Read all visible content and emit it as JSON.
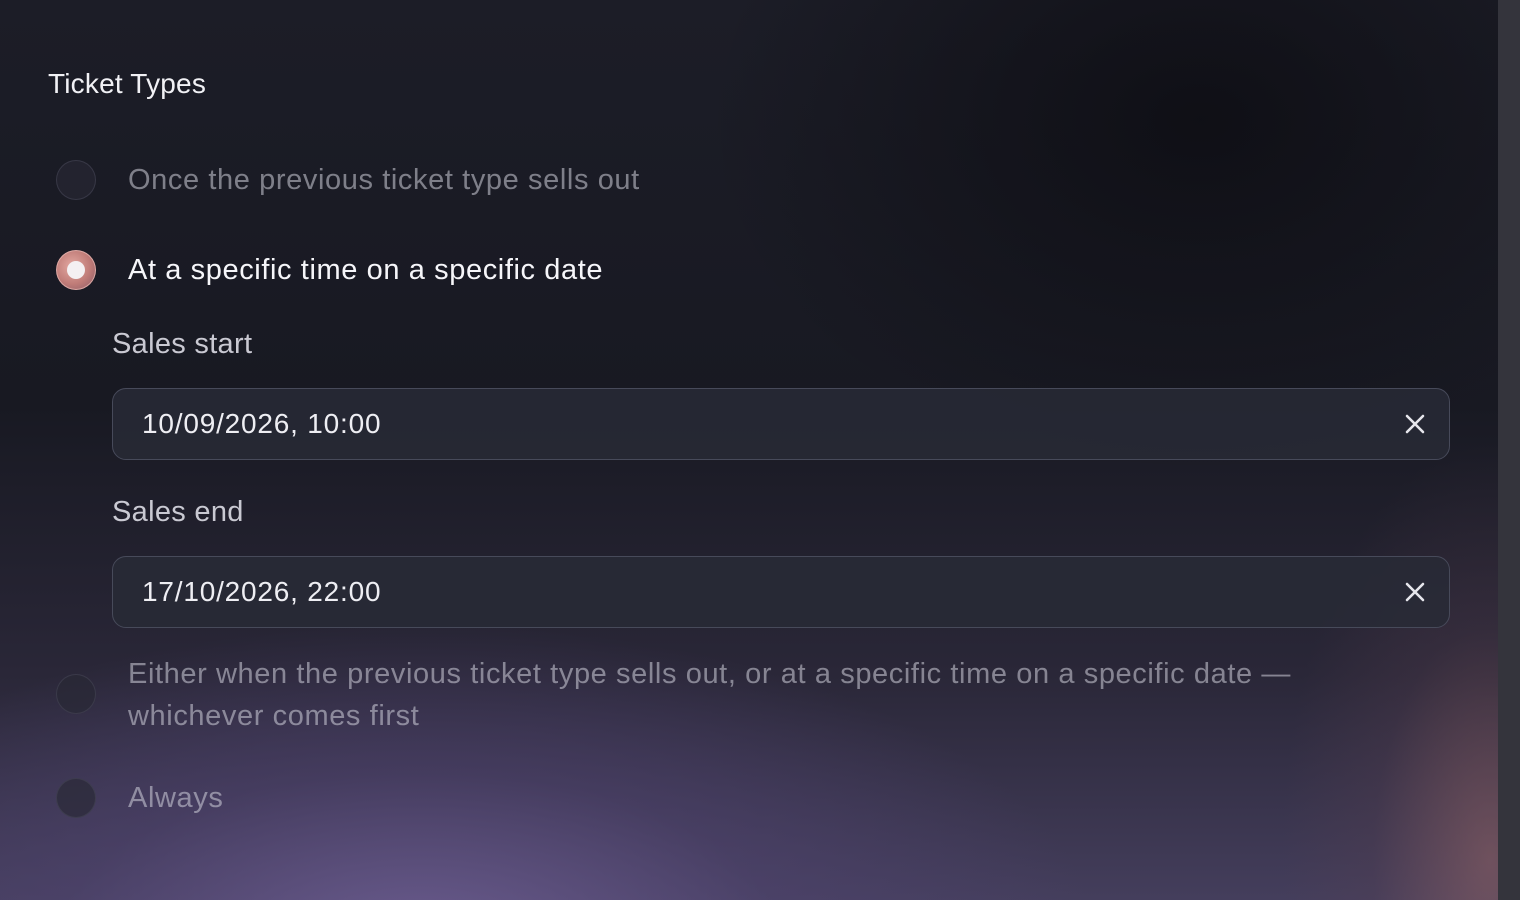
{
  "section": {
    "title": "Ticket Types"
  },
  "options": [
    {
      "label": "Once the previous ticket type sells out",
      "selected": false
    },
    {
      "label": "At a specific time on a specific date",
      "selected": true
    },
    {
      "label": "Either when the previous ticket type sells out, or at a specific time on a specific date — whichever comes first",
      "selected": false
    },
    {
      "label": "Always",
      "selected": false
    }
  ],
  "sales_start": {
    "label": "Sales start",
    "value": "10/09/2026, 10:00",
    "clear_icon": "close-icon"
  },
  "sales_end": {
    "label": "Sales end",
    "value": "17/10/2026, 22:00",
    "clear_icon": "close-icon"
  },
  "colors": {
    "accent": "#c98a86",
    "field_border": "#474a5a",
    "field_bg": "#282a36"
  }
}
